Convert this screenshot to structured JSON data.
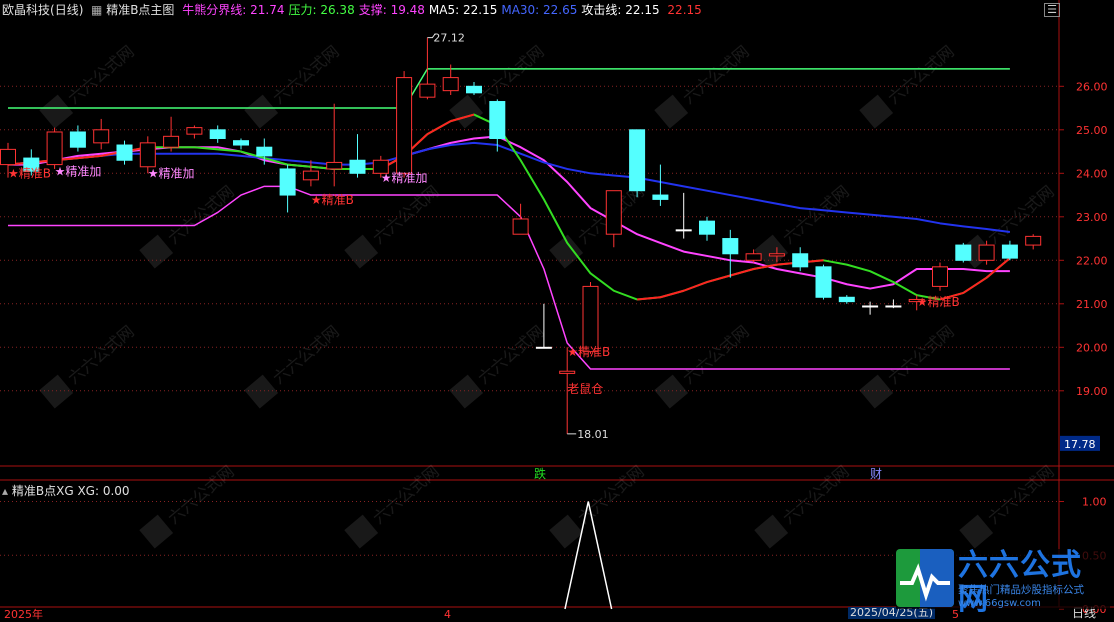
{
  "header": {
    "stock_name": "欧晶科技",
    "period": "(日线)",
    "indicator_name": "精准B点主图",
    "items": [
      {
        "label": "牛熊分界线:",
        "value": "21.74",
        "color": "#ff44ff"
      },
      {
        "label": "压力:",
        "value": "26.38",
        "color": "#44ff44"
      },
      {
        "label": "支撑:",
        "value": "19.48",
        "color": "#ff44ff"
      },
      {
        "label": "MA5:",
        "value": "22.15",
        "color": "#ffffff"
      },
      {
        "label": "MA30:",
        "value": "22.65",
        "color": "#4466ff"
      },
      {
        "label": "攻击线:",
        "value": "22.15",
        "color": "#ffffff"
      },
      {
        "label": "",
        "value": "22.15",
        "color": "#ff3333"
      }
    ]
  },
  "sub_header": {
    "indicator": "精准B点XG",
    "label": "XG:",
    "value": "0.00"
  },
  "bottom_axis": {
    "left_date": "2025年",
    "month_mark": "4",
    "cursor_date": "2025/04/25(五)",
    "mid_mark": "5",
    "period_tab": "日线"
  },
  "watermark": {
    "brand": "六六公式网",
    "slogan": "聚焦热门精品炒股指标公式",
    "url": "www.66gsw.com"
  },
  "chart_data": [
    {
      "type": "candlestick",
      "title": "精准B点主图",
      "y_ticks": [
        26.0,
        25.0,
        24.0,
        23.0,
        22.0,
        21.0,
        20.0,
        19.0
      ],
      "y_tick_labels": [
        "26.00",
        "25.00",
        "24.00",
        "23.00",
        "22.00",
        "21.00",
        "20.00",
        "19.00"
      ],
      "ylim": [
        17.4,
        27.8
      ],
      "current_price_label": "17.78",
      "high_annotation": "27.12",
      "low_annotation": "18.01",
      "candles": [
        {
          "o": 24.2,
          "c": 24.55,
          "h": 24.7,
          "l": 23.9
        },
        {
          "o": 24.35,
          "c": 24.05,
          "h": 24.55,
          "l": 23.95
        },
        {
          "o": 24.2,
          "c": 24.95,
          "h": 25.05,
          "l": 24.1
        },
        {
          "o": 24.95,
          "c": 24.6,
          "h": 25.1,
          "l": 24.5
        },
        {
          "o": 24.7,
          "c": 25.0,
          "h": 25.25,
          "l": 24.55
        },
        {
          "o": 24.65,
          "c": 24.3,
          "h": 24.75,
          "l": 24.2
        },
        {
          "o": 24.15,
          "c": 24.7,
          "h": 24.85,
          "l": 24.0
        },
        {
          "o": 24.6,
          "c": 24.85,
          "h": 25.3,
          "l": 24.5
        },
        {
          "o": 24.9,
          "c": 25.05,
          "h": 25.1,
          "l": 24.8
        },
        {
          "o": 25.0,
          "c": 24.8,
          "h": 25.1,
          "l": 24.7
        },
        {
          "o": 24.75,
          "c": 24.65,
          "h": 24.8,
          "l": 24.55
        },
        {
          "o": 24.6,
          "c": 24.4,
          "h": 24.8,
          "l": 24.2
        },
        {
          "o": 24.1,
          "c": 23.5,
          "h": 24.2,
          "l": 23.1
        },
        {
          "o": 23.85,
          "c": 24.05,
          "h": 24.3,
          "l": 23.7
        },
        {
          "o": 24.1,
          "c": 24.25,
          "h": 25.6,
          "l": 23.7
        },
        {
          "o": 24.3,
          "c": 24.0,
          "h": 24.9,
          "l": 23.9
        },
        {
          "o": 24.0,
          "c": 24.3,
          "h": 24.4,
          "l": 23.9
        },
        {
          "o": 24.0,
          "c": 26.2,
          "h": 26.35,
          "l": 23.9
        },
        {
          "o": 25.75,
          "c": 26.05,
          "h": 27.12,
          "l": 25.7
        },
        {
          "o": 25.9,
          "c": 26.2,
          "h": 26.5,
          "l": 25.8
        },
        {
          "o": 26.0,
          "c": 25.85,
          "h": 26.1,
          "l": 25.8
        },
        {
          "o": 25.65,
          "c": 24.8,
          "h": 25.7,
          "l": 24.5
        },
        {
          "o": 22.6,
          "c": 22.95,
          "h": 23.3,
          "l": 22.6
        },
        {
          "o": 20.0,
          "c": 20.0,
          "h": 21.0,
          "l": 20.0
        },
        {
          "o": 19.4,
          "c": 19.45,
          "h": 20.0,
          "l": 18.01
        },
        {
          "o": 19.9,
          "c": 21.4,
          "h": 21.5,
          "l": 19.85
        },
        {
          "o": 22.6,
          "c": 23.6,
          "h": 23.6,
          "l": 22.3
        },
        {
          "o": 25.0,
          "c": 23.6,
          "h": 25.0,
          "l": 23.45
        },
        {
          "o": 23.5,
          "c": 23.4,
          "h": 24.2,
          "l": 23.25
        },
        {
          "o": 22.7,
          "c": 22.7,
          "h": 23.55,
          "l": 22.5
        },
        {
          "o": 22.9,
          "c": 22.6,
          "h": 23.0,
          "l": 22.45
        },
        {
          "o": 22.5,
          "c": 22.15,
          "h": 22.7,
          "l": 21.6
        },
        {
          "o": 22.0,
          "c": 22.15,
          "h": 22.25,
          "l": 21.95
        },
        {
          "o": 22.1,
          "c": 22.15,
          "h": 22.3,
          "l": 21.95
        },
        {
          "o": 22.15,
          "c": 21.85,
          "h": 22.3,
          "l": 21.75
        },
        {
          "o": 21.85,
          "c": 21.15,
          "h": 21.9,
          "l": 21.1
        },
        {
          "o": 21.15,
          "c": 21.05,
          "h": 21.2,
          "l": 21.0
        },
        {
          "o": 20.95,
          "c": 20.95,
          "h": 21.05,
          "l": 20.75
        },
        {
          "o": 20.95,
          "c": 20.95,
          "h": 21.1,
          "l": 20.9
        },
        {
          "o": 21.05,
          "c": 21.1,
          "h": 21.2,
          "l": 20.85
        },
        {
          "o": 21.4,
          "c": 21.85,
          "h": 21.95,
          "l": 21.3
        },
        {
          "o": 22.35,
          "c": 22.0,
          "h": 22.4,
          "l": 21.95
        },
        {
          "o": 22.0,
          "c": 22.35,
          "h": 22.45,
          "l": 21.9
        },
        {
          "o": 22.35,
          "c": 22.05,
          "h": 22.45,
          "l": 22.0
        },
        {
          "o": 22.35,
          "c": 22.55,
          "h": 22.6,
          "l": 22.25
        }
      ],
      "series": [
        {
          "name": "压力",
          "color": "#44ff77",
          "values": [
            25.5,
            25.5,
            25.5,
            25.5,
            25.5,
            25.5,
            25.5,
            25.5,
            25.5,
            25.5,
            25.5,
            25.5,
            25.5,
            25.5,
            25.5,
            25.5,
            25.5,
            25.5,
            26.4,
            26.4,
            26.4,
            26.4,
            26.4,
            26.4,
            26.4,
            26.4,
            26.4,
            26.4,
            26.4,
            26.4,
            26.4,
            26.4,
            26.4,
            26.4,
            26.4,
            26.4,
            26.4,
            26.4,
            26.4,
            26.4,
            26.4,
            26.4,
            26.4,
            26.4
          ]
        },
        {
          "name": "支撑",
          "color": "#ff44ff",
          "values": [
            22.8,
            22.8,
            22.8,
            22.8,
            22.8,
            22.8,
            22.8,
            22.8,
            22.8,
            23.1,
            23.5,
            23.7,
            23.7,
            23.5,
            23.5,
            23.5,
            23.5,
            23.5,
            23.5,
            23.5,
            23.5,
            23.5,
            23.0,
            21.8,
            20.1,
            19.5,
            19.5,
            19.5,
            19.5,
            19.5,
            19.5,
            19.5,
            19.5,
            19.5,
            19.5,
            19.5,
            19.5,
            19.5,
            19.5,
            19.5,
            19.5,
            19.5,
            19.5,
            19.5
          ]
        },
        {
          "name": "牛熊分界线",
          "color": "#ff44ff",
          "values": [
            24.2,
            24.2,
            24.3,
            24.4,
            24.45,
            24.5,
            24.55,
            24.6,
            24.6,
            24.6,
            24.5,
            24.3,
            24.2,
            24.15,
            24.1,
            24.1,
            24.1,
            24.4,
            24.55,
            24.7,
            24.8,
            24.85,
            24.6,
            24.3,
            23.8,
            23.2,
            22.9,
            22.6,
            22.4,
            22.2,
            22.1,
            22.0,
            21.95,
            21.8,
            21.7,
            21.6,
            21.45,
            21.35,
            21.45,
            21.8,
            21.8,
            21.8,
            21.75,
            21.75
          ]
        },
        {
          "name": "MA30",
          "color": "#2233ee",
          "values": [
            24.2,
            24.25,
            24.3,
            24.35,
            24.4,
            24.45,
            24.45,
            24.45,
            24.45,
            24.45,
            24.4,
            24.35,
            24.3,
            24.25,
            24.2,
            24.2,
            24.25,
            24.4,
            24.55,
            24.65,
            24.7,
            24.65,
            24.45,
            24.25,
            24.1,
            24.0,
            23.95,
            23.9,
            23.8,
            23.7,
            23.6,
            23.5,
            23.4,
            23.3,
            23.2,
            23.15,
            23.1,
            23.05,
            23.0,
            22.95,
            22.85,
            22.78,
            22.72,
            22.65
          ]
        },
        {
          "name": "攻击线",
          "color": "#33dd22",
          "values": [
            24.2,
            24.25,
            24.3,
            24.35,
            24.4,
            24.5,
            24.6,
            24.6,
            24.6,
            24.55,
            24.5,
            24.35,
            24.2,
            24.15,
            24.1,
            24.1,
            24.1,
            24.4,
            24.9,
            25.2,
            25.35,
            25.1,
            24.3,
            23.4,
            22.4,
            21.7,
            21.3,
            21.1,
            21.15,
            21.3,
            21.5,
            21.65,
            21.8,
            21.9,
            21.95,
            22.0,
            21.9,
            21.75,
            21.5,
            21.2,
            21.1,
            21.25,
            21.6,
            22.05
          ]
        }
      ],
      "annotations": [
        {
          "text": "★精准B",
          "color": "#ff3333"
        },
        {
          "text": "★精准加",
          "color": "#ff88ff"
        },
        {
          "text": "★精准加",
          "color": "#ff88ff"
        },
        {
          "text": "★精准B",
          "color": "#ff3333"
        },
        {
          "text": "★精准加",
          "color": "#ff88ff"
        },
        {
          "text": "★精准B",
          "color": "#ff3333"
        },
        {
          "text": "老鼠仓",
          "color": "#ff3333"
        },
        {
          "text": "★精准B",
          "color": "#ff3333"
        }
      ],
      "events": [
        {
          "text": "跌",
          "color": "#22dd22"
        },
        {
          "text": "财",
          "color": "#8888ff"
        }
      ]
    },
    {
      "type": "line",
      "title": "精准B点XG",
      "y_ticks": [
        1.0,
        0.5,
        0.0
      ],
      "y_tick_labels": [
        "1.00",
        "0.50",
        "0.00"
      ],
      "ylim": [
        0,
        1.15
      ],
      "series": [
        {
          "name": "XG",
          "color": "#ffffff",
          "values": [
            0,
            0,
            0,
            0,
            0,
            0,
            0,
            0,
            0,
            0,
            0,
            0,
            0,
            0,
            0,
            0,
            0,
            0,
            0,
            0,
            0,
            0,
            0,
            0,
            1,
            0,
            0,
            0,
            0,
            0,
            0,
            0,
            0,
            0,
            0,
            0,
            0,
            0,
            0,
            0,
            0,
            0,
            0,
            0,
            0
          ]
        }
      ]
    }
  ]
}
